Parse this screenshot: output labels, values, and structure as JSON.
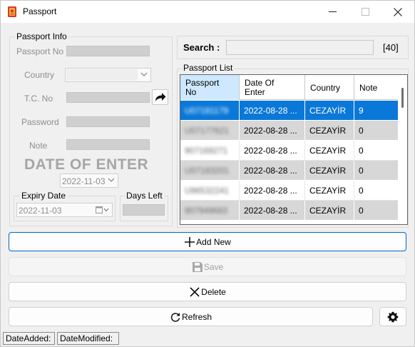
{
  "window": {
    "title": "Passport",
    "icon": "passport-app-icon",
    "controls": {
      "minimize": "minimize-icon",
      "maximize": "maximize-icon",
      "close": "close-icon"
    }
  },
  "passport_info": {
    "legend": "Passport Info",
    "passport_no_label": "Passport No",
    "country_label": "Country",
    "tc_no_label": "T.C. No",
    "password_label": "Password",
    "note_label": "Note",
    "date_of_enter_title": "DATE OF ENTER",
    "date_of_enter_value": "2022-11-03",
    "expiry_date_label": "Expiry Date",
    "expiry_date_value": "2022-11-03",
    "days_left_label": "Days Left"
  },
  "search": {
    "label": "Search :",
    "value": "",
    "count": "[40]"
  },
  "passport_list": {
    "legend": "Passport List",
    "columns": [
      "Passport No",
      "Date Of Enter",
      "Country",
      "Note"
    ],
    "rows": [
      {
        "passport_no": "U07181179",
        "date": "2022-08-28 ...",
        "country": "CEZAYİR",
        "note": "9",
        "selected": true
      },
      {
        "passport_no": "U07177621",
        "date": "2022-08-28 ...",
        "country": "CEZAYİR",
        "note": "0"
      },
      {
        "passport_no": "907169271",
        "date": "2022-08-28 ...",
        "country": "CEZAYİR",
        "note": "0"
      },
      {
        "passport_no": "U07183201",
        "date": "2022-08-28 ...",
        "country": "CEZAYİR",
        "note": "0"
      },
      {
        "passport_no": "U96532241",
        "date": "2022-08-28 ...",
        "country": "CEZAYİR",
        "note": "0"
      },
      {
        "passport_no": "907949683",
        "date": "2022-08-28 ...",
        "country": "CEZAYİR",
        "note": "0"
      }
    ]
  },
  "buttons": {
    "add_new": "Add New",
    "save": "Save",
    "delete": "Delete",
    "refresh": "Refresh"
  },
  "status_bar": {
    "date_added": "DateAdded:",
    "date_modified": "DateModified:"
  },
  "colors": {
    "selection": "#0a78d8",
    "header_selected": "#cde8ff",
    "accent_border": "#0067c0"
  }
}
